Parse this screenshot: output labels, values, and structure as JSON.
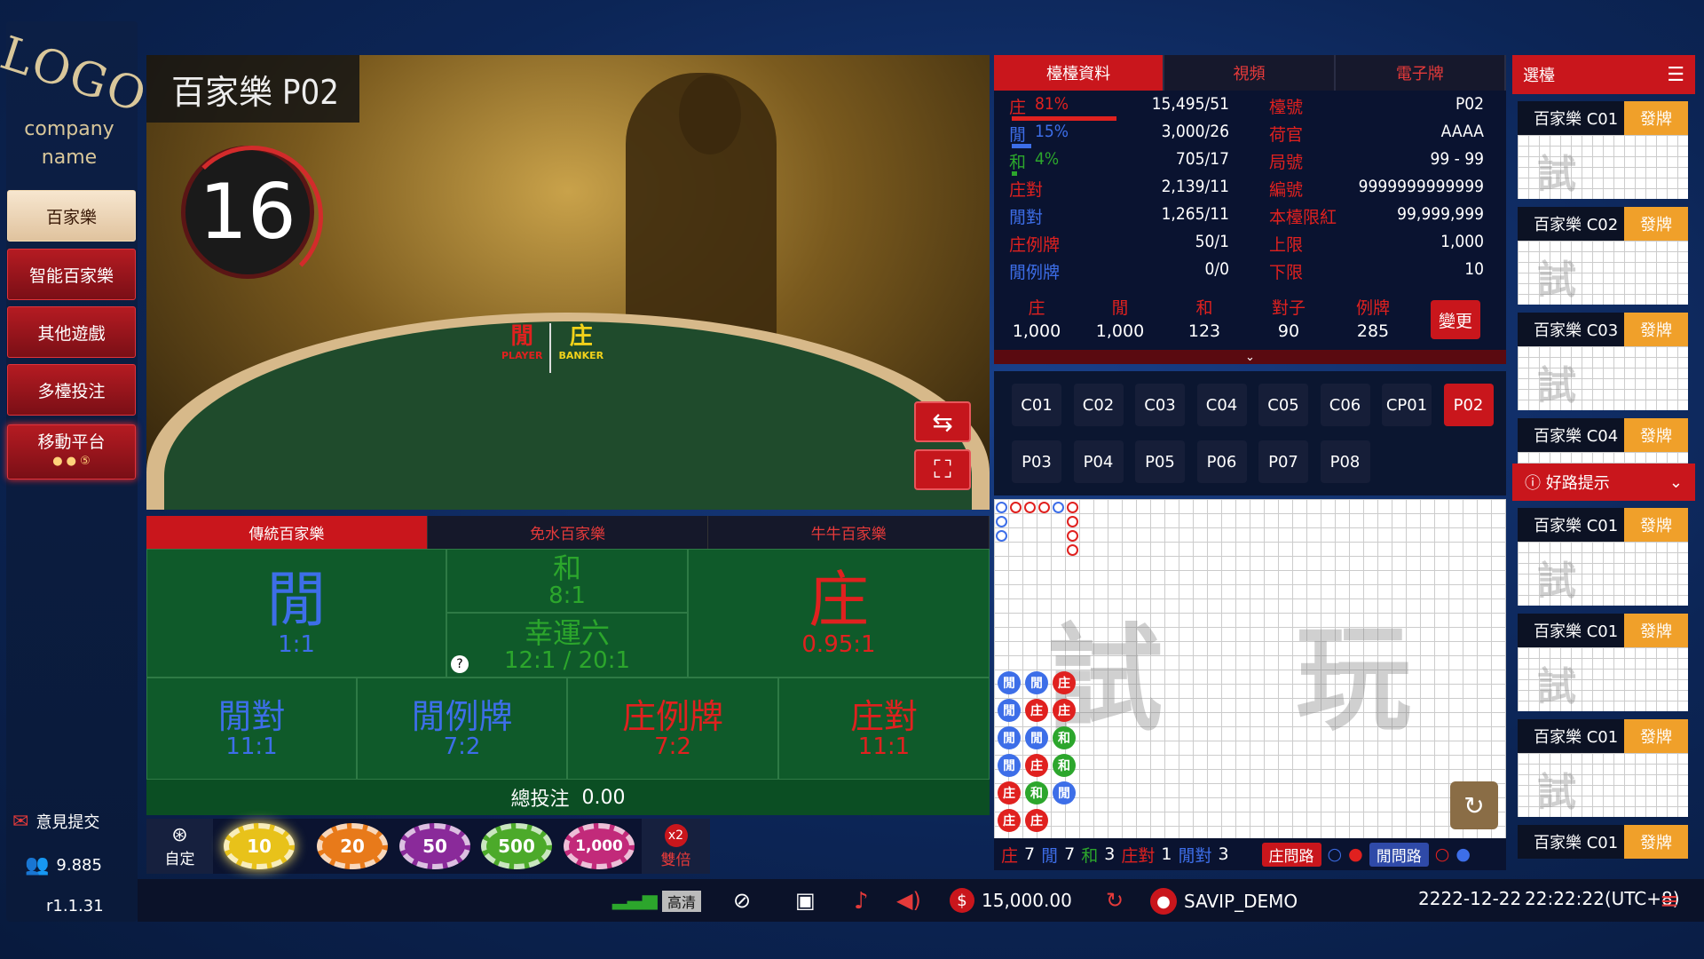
{
  "brand": {
    "logo": "LOGO",
    "company": "company",
    "name": "name"
  },
  "sidebar": {
    "items": [
      {
        "label": "百家樂",
        "active": true
      },
      {
        "label": "智能百家樂"
      },
      {
        "label": "其他遊戲"
      },
      {
        "label": "多檯投注"
      },
      {
        "label": "移動平台"
      }
    ],
    "feedback": "意見提交",
    "online": "9.885",
    "version": "r1.1.31"
  },
  "video": {
    "title": "百家樂 P02",
    "countdown": "16",
    "player_label": "閒",
    "player_en": "PLAYER",
    "banker_label": "庄",
    "banker_en": "BANKER"
  },
  "bet_tabs": [
    "傳統百家樂",
    "免水百家樂",
    "牛牛百家樂"
  ],
  "bets": {
    "player": {
      "name": "閒",
      "odds": "1:1"
    },
    "tie": {
      "name": "和",
      "odds": "8:1"
    },
    "lucky6": {
      "name": "幸運六",
      "odds": "12:1 / 20:1"
    },
    "banker": {
      "name": "庄",
      "odds": "0.95:1"
    },
    "player_pair": {
      "name": "閒對",
      "odds": "11:1"
    },
    "player_pair_card": {
      "name": "閒例牌",
      "odds": "7:2"
    },
    "banker_pair_card": {
      "name": "庄例牌",
      "odds": "7:2"
    },
    "banker_pair": {
      "name": "庄對",
      "odds": "11:1"
    },
    "total_label": "總投注",
    "total_value": "0.00"
  },
  "chips": {
    "custom": "自定",
    "values": [
      "10",
      "20",
      "50",
      "500",
      "1,000"
    ],
    "double_badge": "x2",
    "double": "雙倍"
  },
  "bottom": {
    "quality": "高清",
    "balance": "15,000.00",
    "user": "SAVIP_DEMO",
    "date": "2222-12-22",
    "time": "22:22:22(UTC+8)"
  },
  "info_tabs": [
    "檯檯資料",
    "視頻",
    "電子牌"
  ],
  "stats": [
    {
      "label": "庄",
      "pct": "81%",
      "value": "15,495/51",
      "color": "#e0211f"
    },
    {
      "label": "閒",
      "pct": "15%",
      "value": "3,000/26",
      "color": "#3d6ee8"
    },
    {
      "label": "和",
      "pct": "4%",
      "value": "705/17",
      "color": "#2ca62c"
    },
    {
      "label": "庄對",
      "pct": "",
      "value": "2,139/11",
      "color": "#e0211f"
    },
    {
      "label": "閒對",
      "pct": "",
      "value": "1,265/11",
      "color": "#3d6ee8"
    },
    {
      "label": "庄例牌",
      "pct": "",
      "value": "50/1",
      "color": "#e0211f"
    },
    {
      "label": "閒例牌",
      "pct": "",
      "value": "0/0",
      "color": "#3d6ee8"
    }
  ],
  "table_info": [
    {
      "label": "檯號",
      "value": "P02"
    },
    {
      "label": "荷官",
      "value": "AAAA"
    },
    {
      "label": "局號",
      "value": "99 - 99"
    },
    {
      "label": "編號",
      "value": "9999999999999"
    },
    {
      "label": "本檯限紅",
      "value": "99,999,999"
    },
    {
      "label": "上限",
      "value": "1,000"
    },
    {
      "label": "下限",
      "value": "10"
    }
  ],
  "stakes": [
    {
      "label": "庄",
      "value": "1,000"
    },
    {
      "label": "閒",
      "value": "1,000"
    },
    {
      "label": "和",
      "value": "123"
    },
    {
      "label": "對子",
      "value": "90"
    },
    {
      "label": "例牌",
      "value": "285"
    }
  ],
  "change_label": "變更",
  "tables": [
    "C01",
    "C02",
    "C03",
    "C04",
    "C05",
    "C06",
    "CP01",
    "P02",
    "P03",
    "P04",
    "P05",
    "P06",
    "P07",
    "P08"
  ],
  "roadmap": {
    "watermark": "試玩",
    "footer": [
      {
        "label": "庄",
        "value": "7"
      },
      {
        "label": "閒",
        "value": "7"
      },
      {
        "label": "和",
        "value": "3"
      },
      {
        "label": "庄對",
        "value": "1"
      },
      {
        "label": "閒對",
        "value": "3"
      }
    ],
    "banker_ask": "庄問路",
    "player_ask": "閒問路",
    "bead": [
      [
        "閒",
        "閒",
        "庄"
      ],
      [
        "閒",
        "庄",
        "庄"
      ],
      [
        "閒",
        "閒",
        "和"
      ],
      [
        "閒",
        "庄",
        "和"
      ],
      [
        "庄",
        "和",
        "閒"
      ],
      [
        "庄",
        "庄"
      ]
    ]
  },
  "right_panel": {
    "header": "選檯",
    "hint": "好路提示",
    "deal": "發牌",
    "watermark": "試玩",
    "tables_top": [
      "百家樂 C01",
      "百家樂 C02",
      "百家樂 C03",
      "百家樂 C04"
    ],
    "tables_hint": [
      "百家樂 C01",
      "百家樂 C01",
      "百家樂 C01",
      "百家樂 C01"
    ]
  }
}
